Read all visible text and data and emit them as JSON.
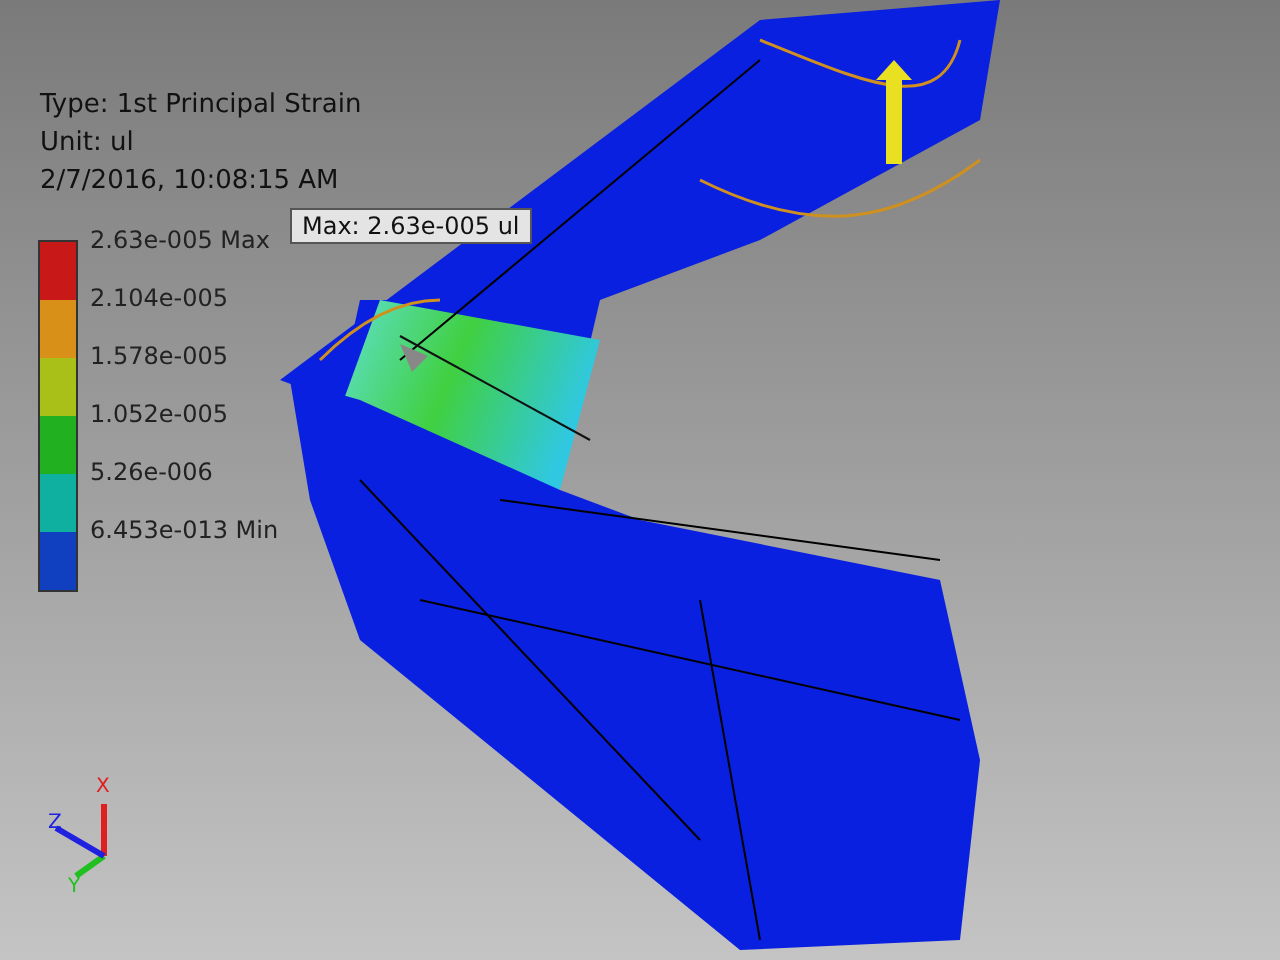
{
  "info": {
    "type": "Type: 1st Principal Strain",
    "unit": "Unit: ul",
    "timestamp": "2/7/2016, 10:08:15 AM"
  },
  "probe": {
    "text": "Max: 2.63e-005 ul"
  },
  "legend": {
    "labels": [
      "2.63e-005 Max",
      "2.104e-005",
      "1.578e-005",
      "1.052e-005",
      "5.26e-006",
      "6.453e-013 Min"
    ],
    "bands": [
      {
        "color": "#c81818"
      },
      {
        "color": "#d89018"
      },
      {
        "color": "#a8c018"
      },
      {
        "color": "#20b020"
      },
      {
        "color": "#10b0a0"
      },
      {
        "color": "#1040c0"
      }
    ]
  },
  "triad": {
    "axes": [
      {
        "label": "X",
        "color": "#e02020"
      },
      {
        "label": "Y",
        "color": "#20c020"
      },
      {
        "label": "Z",
        "color": "#2020e0"
      }
    ]
  }
}
